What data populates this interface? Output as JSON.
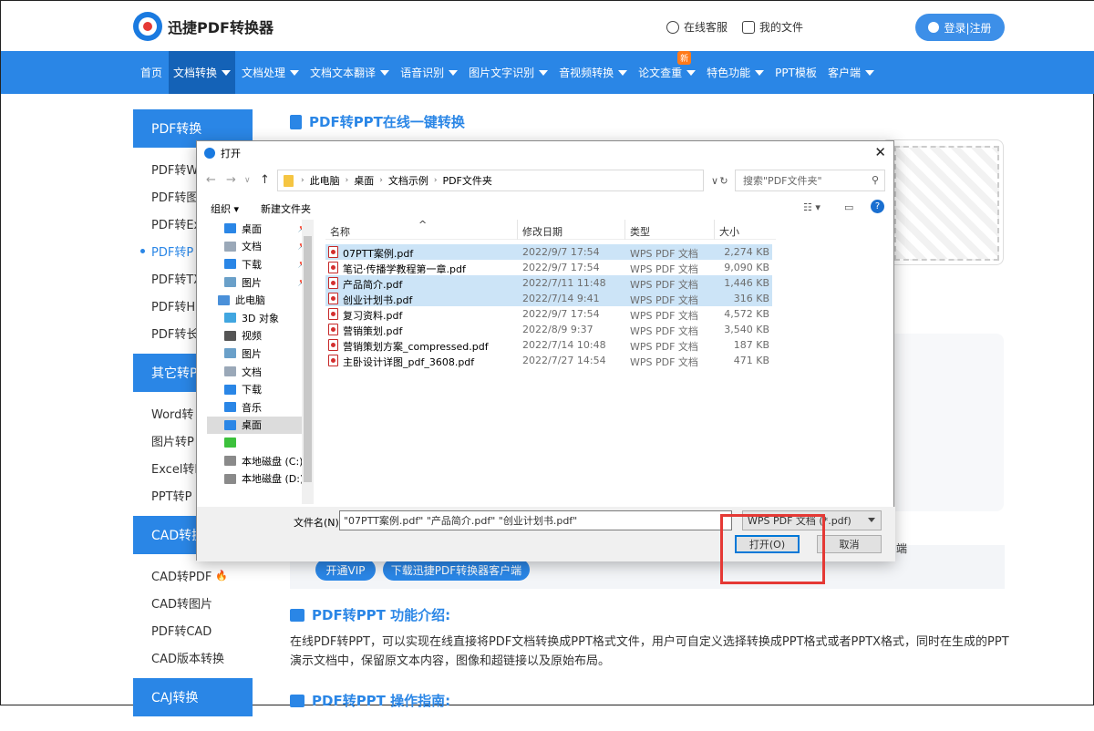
{
  "header": {
    "brand": "迅捷PDF转换器",
    "service": "在线客服",
    "my_files": "我的文件",
    "login": "登录|注册"
  },
  "nav": [
    {
      "label": "首页",
      "caret": false,
      "active": false
    },
    {
      "label": "文档转换",
      "caret": true,
      "active": true
    },
    {
      "label": "文档处理",
      "caret": true,
      "active": false
    },
    {
      "label": "文档文本翻译",
      "caret": true,
      "active": false
    },
    {
      "label": "语音识别",
      "caret": true,
      "active": false
    },
    {
      "label": "图片文字识别",
      "caret": true,
      "active": false
    },
    {
      "label": "音视频转换",
      "caret": true,
      "active": false
    },
    {
      "label": "论文查重",
      "caret": true,
      "active": false,
      "badge": "新"
    },
    {
      "label": "特色功能",
      "caret": true,
      "active": false
    },
    {
      "label": "PPT模板",
      "caret": false,
      "active": false
    },
    {
      "label": "客户端",
      "caret": true,
      "active": false
    }
  ],
  "sidebar": {
    "groups": [
      {
        "title": "PDF转换",
        "items": [
          "PDF转W",
          "PDF转图",
          "PDF转Ex",
          "PDF转P",
          "PDF转TX",
          "PDF转H",
          "PDF转长"
        ]
      },
      {
        "title": "其它转P",
        "items": [
          "Word转",
          "图片转P",
          "Excel转P",
          "PPT转P"
        ]
      },
      {
        "title": "CAD转换",
        "items": [
          "CAD转PDF",
          "CAD转图片",
          "PDF转CAD",
          "CAD版本转换"
        ]
      },
      {
        "title": "CAJ转换",
        "items": []
      }
    ]
  },
  "page": {
    "title": "PDF转PPT在线一键转换",
    "promo_tail": "端",
    "vip_btn": "开通VIP",
    "download_btn": "下载迅捷PDF转换器客户端",
    "intro_title": "PDF转PPT 功能介绍:",
    "intro_text": "在线PDF转PPT，可以实现在线直接将PDF文档转换成PPT格式文件，用户可自定义选择转换成PPT格式或者PPTX格式，同时在生成的PPT演示文档中，保留原文本内容，图像和超链接以及原始布局。",
    "guide_title": "PDF转PPT 操作指南:"
  },
  "dialog": {
    "title": "打开",
    "path": [
      "此电脑",
      "桌面",
      "文档示例",
      "PDF文件夹"
    ],
    "search_placeholder": "搜索\"PDF文件夹\"",
    "organize": "组织",
    "new_folder": "新建文件夹",
    "tree": [
      {
        "label": "桌面",
        "icon": "#2a86e6",
        "pinned": true
      },
      {
        "label": "文档",
        "icon": "#9aa8b8",
        "pinned": true
      },
      {
        "label": "下载",
        "icon": "#2a86e6",
        "pinned": true
      },
      {
        "label": "图片",
        "icon": "#6aa0c9",
        "pinned": true
      },
      {
        "label": "此电脑",
        "icon": "#4a90d9",
        "pinned": false
      },
      {
        "label": "3D 对象",
        "icon": "#41a6e0",
        "pinned": false
      },
      {
        "label": "视频",
        "icon": "#555555",
        "pinned": false
      },
      {
        "label": "图片",
        "icon": "#6aa0c9",
        "pinned": false
      },
      {
        "label": "文档",
        "icon": "#9aa8b8",
        "pinned": false
      },
      {
        "label": "下载",
        "icon": "#2a86e6",
        "pinned": false
      },
      {
        "label": "音乐",
        "icon": "#2a86e6",
        "pinned": false
      },
      {
        "label": "桌面",
        "icon": "#2a86e6",
        "pinned": false,
        "selected": true
      },
      {
        "label": "",
        "icon": "#3cc13c",
        "pinned": false
      },
      {
        "label": "本地磁盘 (C:)",
        "icon": "#8a8a8a",
        "pinned": false
      },
      {
        "label": "本地磁盘 (D:)",
        "icon": "#8a8a8a",
        "pinned": false
      }
    ],
    "columns": [
      "名称",
      "修改日期",
      "类型",
      "大小"
    ],
    "files": [
      {
        "name": "07PTT案例.pdf",
        "date": "2022/9/7 17:54",
        "type": "WPS PDF 文档",
        "size": "2,274 KB",
        "selected": true
      },
      {
        "name": "笔记·传播学教程第一章.pdf",
        "date": "2022/9/7 17:54",
        "type": "WPS PDF 文档",
        "size": "9,090 KB",
        "selected": false,
        "focus": true
      },
      {
        "name": "产品简介.pdf",
        "date": "2022/7/11 11:48",
        "type": "WPS PDF 文档",
        "size": "1,446 KB",
        "selected": true
      },
      {
        "name": "创业计划书.pdf",
        "date": "2022/7/14 9:41",
        "type": "WPS PDF 文档",
        "size": "316 KB",
        "selected": true
      },
      {
        "name": "复习资料.pdf",
        "date": "2022/9/7 17:54",
        "type": "WPS PDF 文档",
        "size": "4,572 KB",
        "selected": false
      },
      {
        "name": "营销策划.pdf",
        "date": "2022/8/9 9:37",
        "type": "WPS PDF 文档",
        "size": "3,540 KB",
        "selected": false
      },
      {
        "name": "营销策划方案_compressed.pdf",
        "date": "2022/7/14 10:48",
        "type": "WPS PDF 文档",
        "size": "187 KB",
        "selected": false
      },
      {
        "name": "主卧设计详图_pdf_3608.pdf",
        "date": "2022/7/27 14:54",
        "type": "WPS PDF 文档",
        "size": "471 KB",
        "selected": false
      }
    ],
    "filename_label": "文件名(N):",
    "filename_value": "\"07PTT案例.pdf\" \"产品简介.pdf\" \"创业计划书.pdf\"",
    "filetype": "WPS PDF 文档 (*.pdf)",
    "open": "打开(O)",
    "cancel": "取消"
  },
  "colors": {
    "accent": "#2a86e6",
    "nav_active": "#1462b7",
    "highlight_box": "#e53935",
    "selection": "#cce4f7"
  }
}
